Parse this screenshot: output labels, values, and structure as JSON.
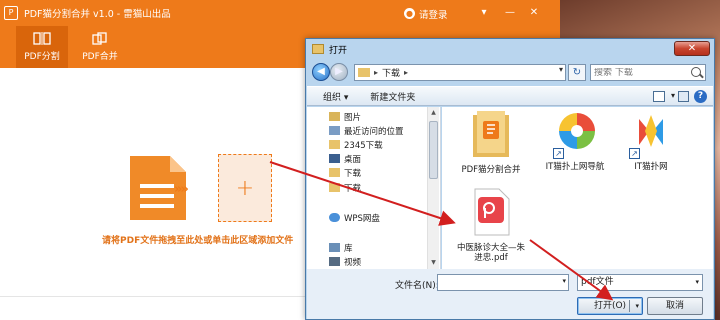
{
  "app": {
    "title": "PDF猫分割合并 v1.0 - 雷猫山出品",
    "logo": "P",
    "login": "请登录",
    "tabs": [
      {
        "label": "PDF分割",
        "icon": "split-icon",
        "active": true
      },
      {
        "label": "PDF合并",
        "icon": "merge-icon",
        "active": false
      }
    ],
    "add_symbol": "+",
    "chevrons": "»»",
    "hint": "请将PDF文件拖拽至此处或单击此区域添加文件",
    "accent": "#ee7a1a"
  },
  "dialog": {
    "title": "打开",
    "close": "✕",
    "address": {
      "arrow": "▸",
      "folder": "下载",
      "dropdown": "▾"
    },
    "search_placeholder": "搜索 下载",
    "commands": {
      "organize": "组织 ▾",
      "new_folder": "新建文件夹"
    },
    "help": "?",
    "nav_items": [
      {
        "label": "图片",
        "icon": "pictures-icon"
      },
      {
        "label": "最近访问的位置",
        "icon": "recent-places-icon"
      },
      {
        "label": "2345下载",
        "icon": "folder-icon"
      },
      {
        "label": "桌面",
        "icon": "desktop-icon"
      },
      {
        "label": "下载",
        "icon": "folder-icon"
      },
      {
        "label": "下载",
        "icon": "folder-icon"
      },
      {
        "label": "WPS网盘",
        "icon": "cloud-icon"
      },
      {
        "label": "库",
        "icon": "library-icon"
      },
      {
        "label": "视频",
        "icon": "video-icon"
      }
    ],
    "files": [
      {
        "name": "PDF猫分割合并",
        "icon": "pdf-split-merge-folder-icon"
      },
      {
        "name": "IT猫扑上网导航",
        "icon": "browser-shortcut-icon"
      },
      {
        "name": "IT猫扑网",
        "icon": "it-maopu-icon"
      },
      {
        "name": "中医脉诊大全—朱进忠.pdf",
        "icon": "pdf-file-icon"
      }
    ],
    "filename_label": "文件名(N):",
    "filename_value": "",
    "filetype": "pdf文件",
    "open_button": "打开(O)",
    "cancel_button": "取消"
  }
}
